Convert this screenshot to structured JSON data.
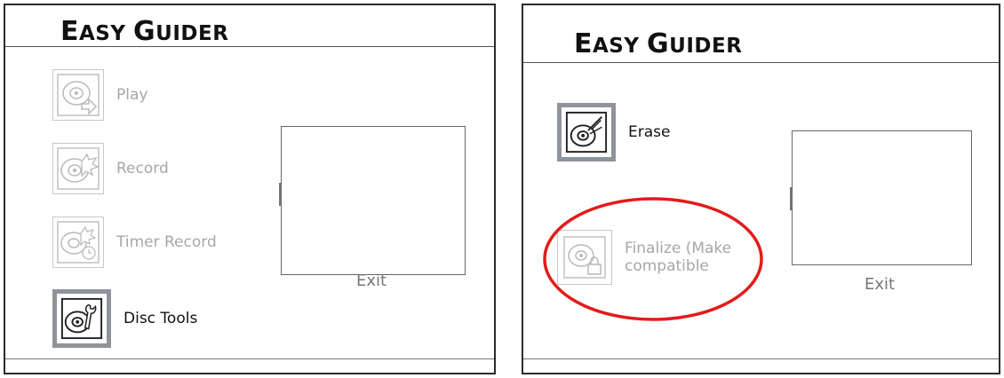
{
  "left": {
    "title": "Easy Guider",
    "items": [
      {
        "label": "Play",
        "icon": "disc-play-icon",
        "state": "disabled"
      },
      {
        "label": "Record",
        "icon": "disc-record-icon",
        "state": "disabled"
      },
      {
        "label": "Timer Record",
        "icon": "disc-timer-record-icon",
        "state": "disabled"
      },
      {
        "label": "Disc Tools",
        "icon": "disc-tools-icon",
        "state": "selected"
      }
    ],
    "exit_label": "Exit"
  },
  "right": {
    "title": "Easy Guider",
    "items": [
      {
        "label": "Erase",
        "icon": "disc-erase-icon",
        "state": "selected"
      },
      {
        "label": "Finalize (Make compatible",
        "icon": "disc-finalize-lock-icon",
        "state": "disabled"
      }
    ],
    "exit_label": "Exit"
  },
  "colors": {
    "highlight": "#e31b1b",
    "disabled_text": "#a7a7a7",
    "selected_border": "#8f949b"
  }
}
